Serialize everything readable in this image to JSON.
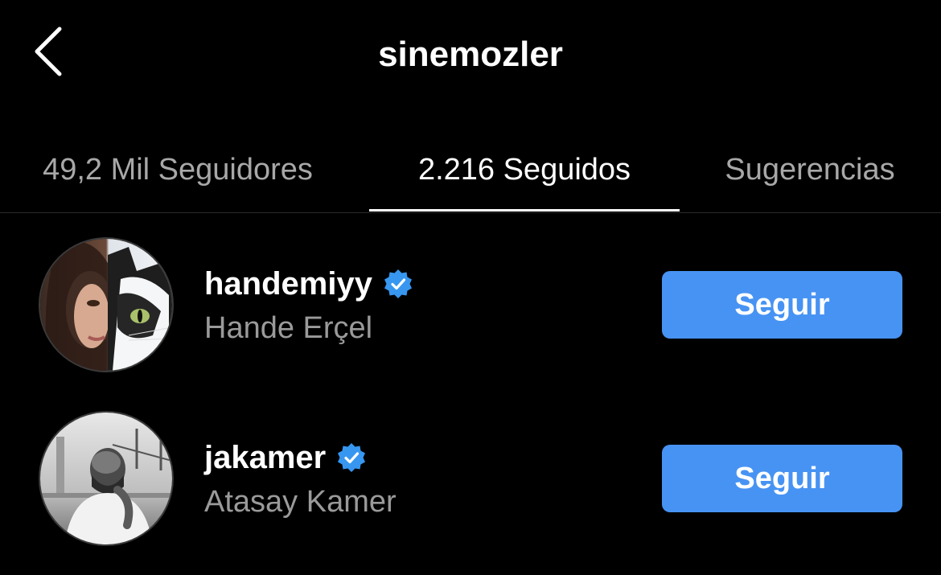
{
  "header": {
    "title": "sinemozler"
  },
  "tabs": [
    {
      "label": "49,2 Mil Seguidores",
      "active": false
    },
    {
      "label": "2.216 Seguidos",
      "active": true
    },
    {
      "label": "Sugerencias",
      "active": false
    }
  ],
  "accounts": [
    {
      "username": "handemiyy",
      "full_name": "Hande Erçel",
      "verified": true,
      "button_label": "Seguir"
    },
    {
      "username": "jakamer",
      "full_name": "Atasay Kamer",
      "verified": true,
      "button_label": "Seguir"
    }
  ],
  "colors": {
    "background": "#000000",
    "accent_button": "#4793f3",
    "verified_badge": "#3797f0",
    "secondary_text": "#9a9a9a"
  }
}
